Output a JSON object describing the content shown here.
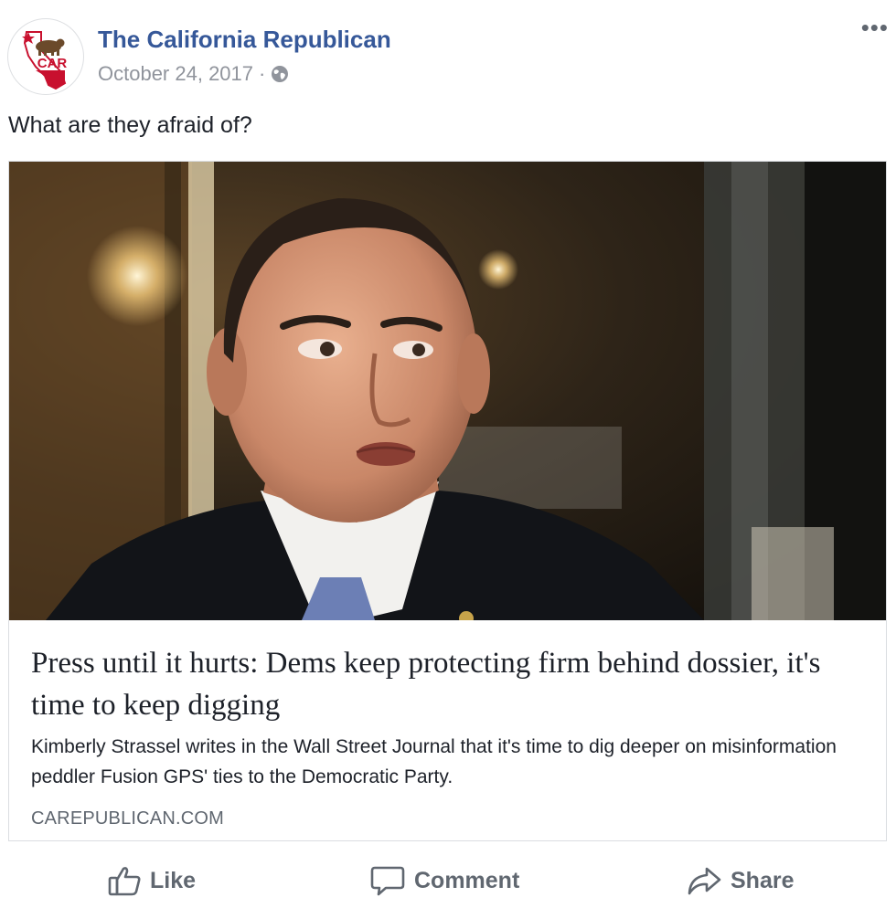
{
  "post": {
    "page_name": "The California Republican",
    "date": "October 24, 2017",
    "separator": "·",
    "visibility_icon": "globe-icon",
    "more_label": "•••",
    "text": "What are they afraid of?"
  },
  "avatar": {
    "logo_text": "CAR",
    "colors": {
      "bear": "#6b4a2b",
      "flag_red": "#c8102e",
      "star": "#c8102e"
    }
  },
  "link": {
    "title": "Press until it hurts: Dems keep protecting firm behind dossier, it's time to keep digging",
    "description": "Kimberly Strassel writes in the Wall Street Journal that it's time to dig deeper on misinformation peddler Fusion GPS' ties to the Democratic Party.",
    "domain": "CAREPUBLICAN.COM",
    "image_icon": "man-in-suit-photo"
  },
  "actions": [
    {
      "label": "Like",
      "icon": "thumbs-up-icon"
    },
    {
      "label": "Comment",
      "icon": "comment-bubble-icon"
    },
    {
      "label": "Share",
      "icon": "share-arrow-icon"
    }
  ],
  "colors": {
    "link_blue": "#365899",
    "meta_gray": "#90949c",
    "action_gray": "#606770",
    "text": "#1d2129"
  }
}
